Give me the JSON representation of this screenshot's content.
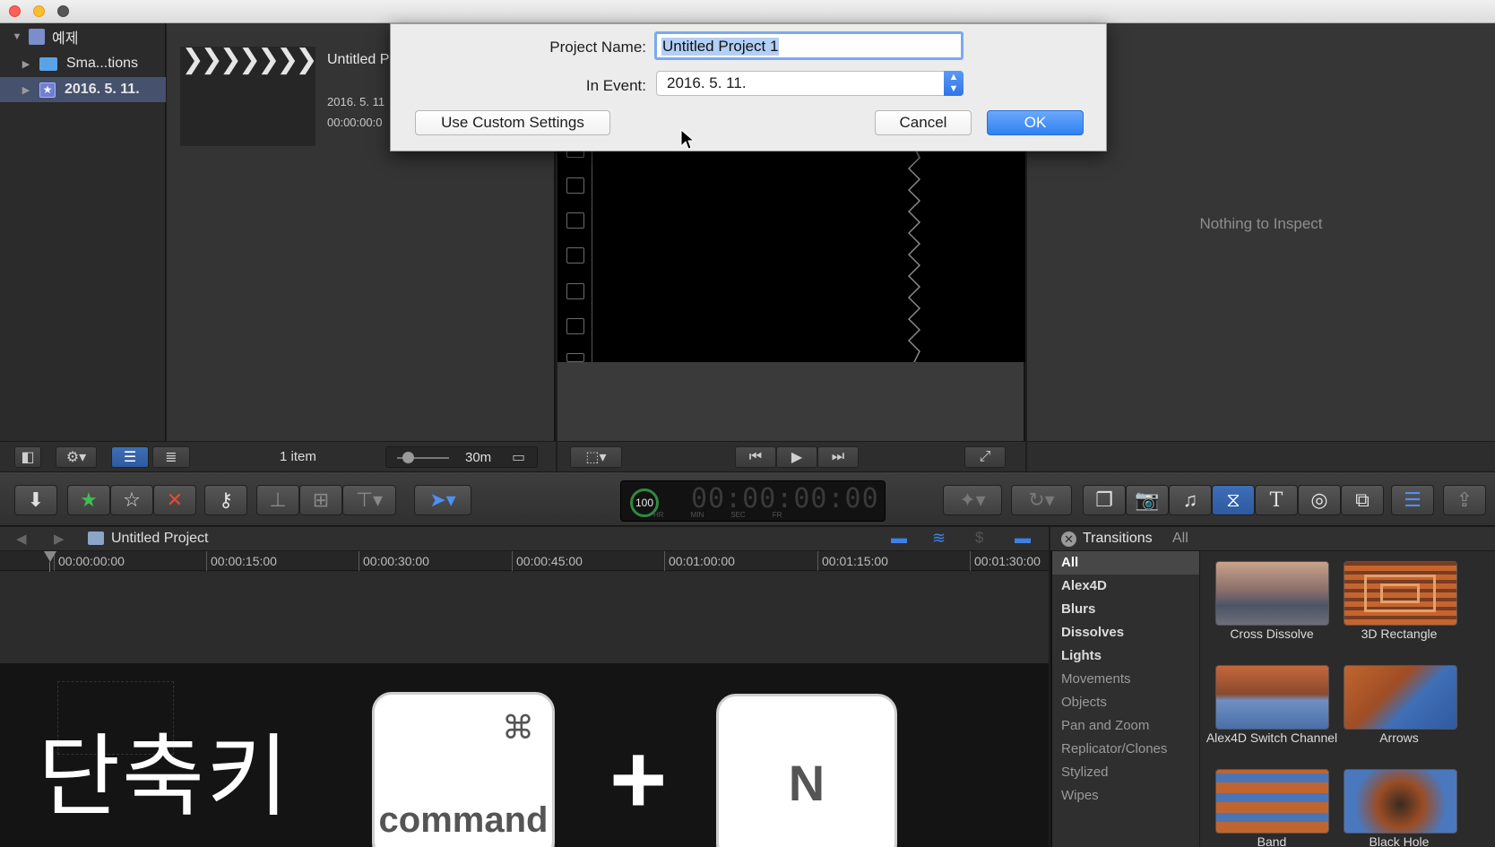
{
  "library": {
    "root": "예제",
    "items": [
      {
        "label": "Sma...tions"
      },
      {
        "label": "2016. 5. 11."
      }
    ]
  },
  "browser": {
    "project_title": "Untitled P",
    "project_date": "2016. 5. 11",
    "project_duration": "00:00:00:0",
    "item_count": "1 item",
    "zoom_label": "30m"
  },
  "inspector": {
    "empty_text": "Nothing to Inspect"
  },
  "dialog": {
    "project_name_label": "Project Name:",
    "project_name_value": "Untitled Project 1",
    "in_event_label": "In Event:",
    "in_event_value": "2016. 5. 11.",
    "custom_button": "Use Custom Settings",
    "cancel_button": "Cancel",
    "ok_button": "OK"
  },
  "toolbar": {
    "timecode": "00:00:00:00",
    "timecode_percent": "100",
    "timecode_units": [
      "HR",
      "MIN",
      "SEC",
      "FR"
    ]
  },
  "timeline": {
    "project_name": "Untitled Project",
    "ticks": [
      "00:00:00:00",
      "00:00:15:00",
      "00:00:30:00",
      "00:00:45:00",
      "00:01:00:00",
      "00:01:15:00",
      "00:01:30:00"
    ]
  },
  "transitions": {
    "title": "Transitions",
    "filter": "All",
    "categories": [
      "All",
      "Alex4D",
      "Blurs",
      "Dissolves",
      "Lights",
      "Movements",
      "Objects",
      "Pan and Zoom",
      "Replicator/Clones",
      "Stylized",
      "Wipes"
    ],
    "items": [
      {
        "label": "Cross Dissolve"
      },
      {
        "label": "3D Rectangle"
      },
      {
        "label": "Alex4D Switch Channel"
      },
      {
        "label": "Arrows"
      },
      {
        "label": "Band"
      },
      {
        "label": "Black Hole"
      }
    ]
  },
  "overlay": {
    "shortcut_text": "단축키",
    "command_symbol": "⌘",
    "command_label": "command",
    "plus": "+",
    "key_label": "N"
  },
  "colors": {
    "accent_blue": "#2f86f6",
    "selection_highlight": "#9fc2f5",
    "reject_red": "#e24a3a",
    "favorite_green": "#3fbf4f"
  }
}
